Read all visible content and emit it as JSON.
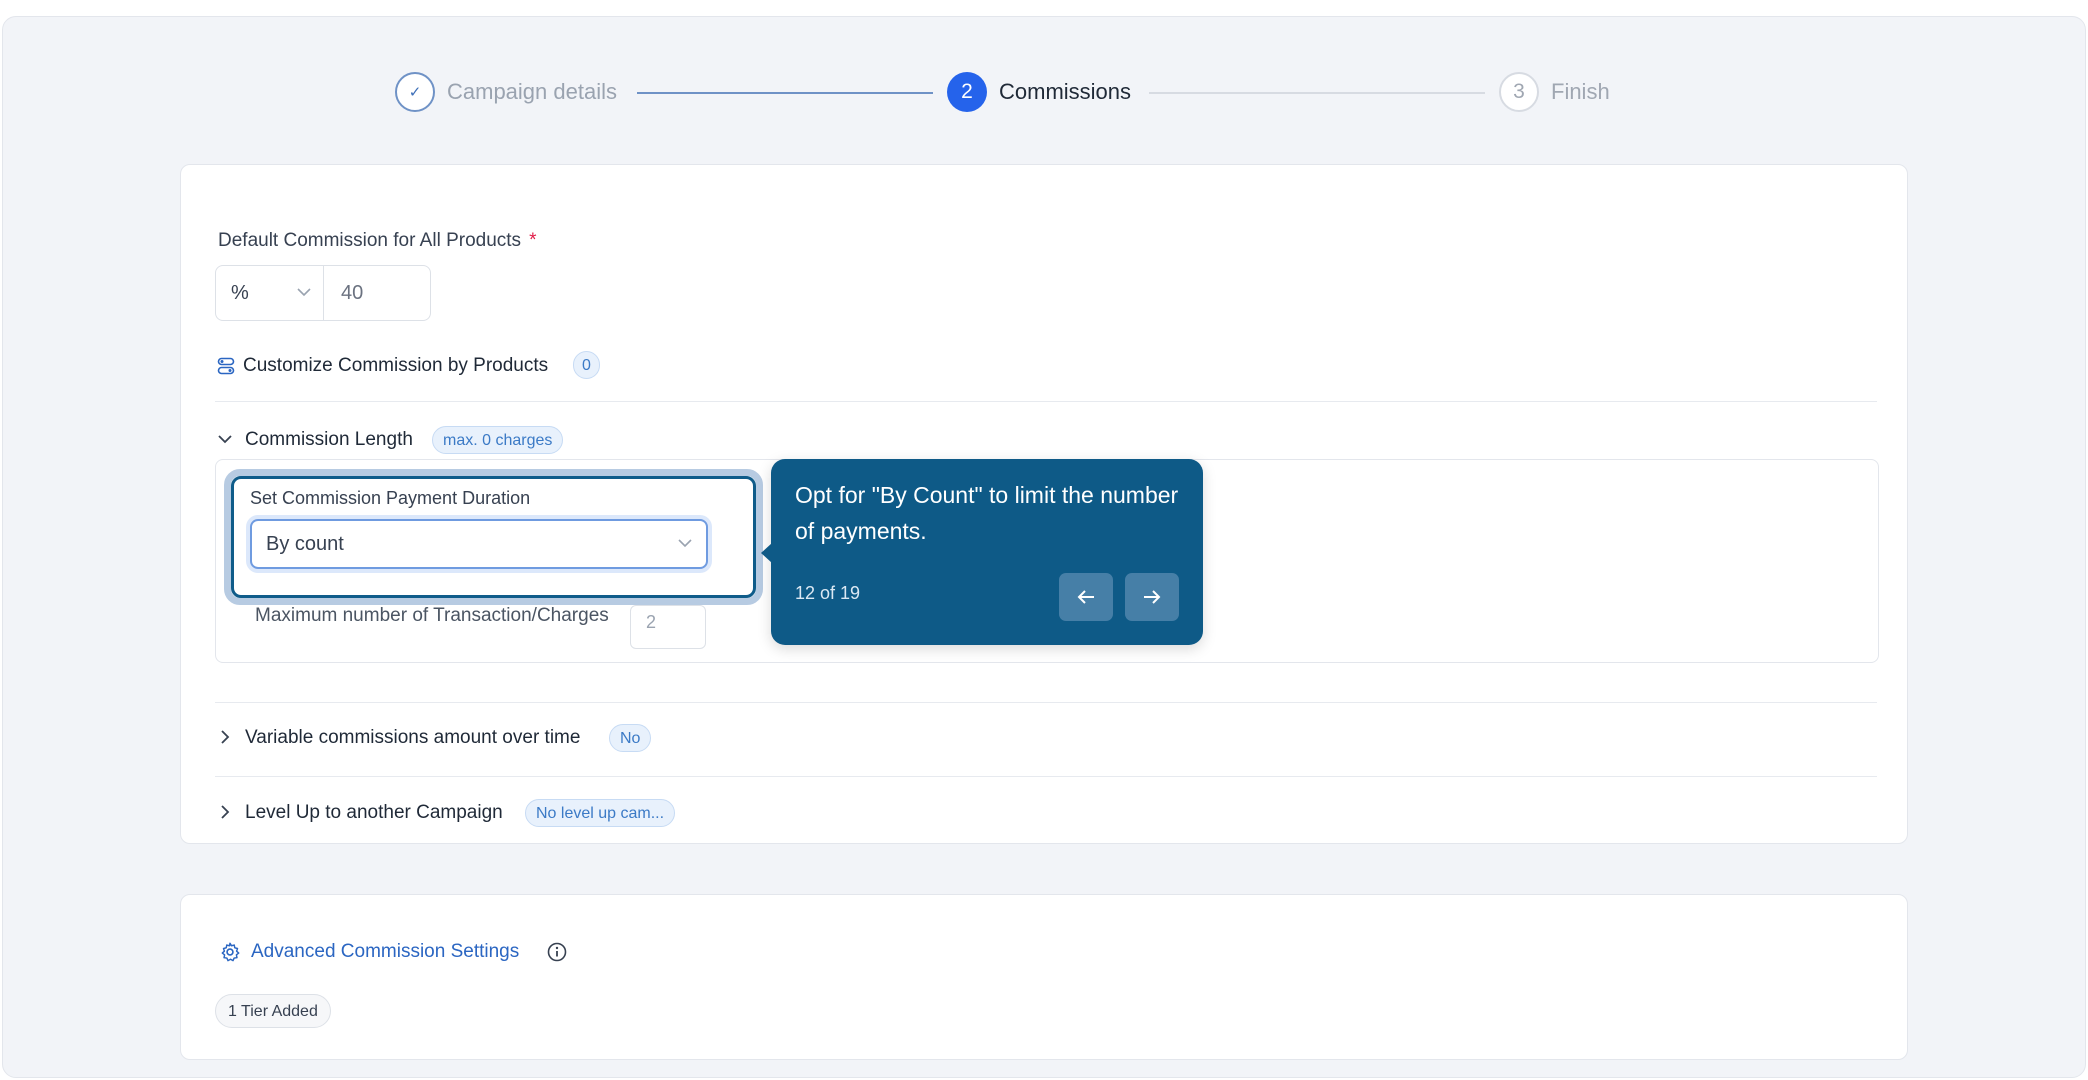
{
  "stepper": {
    "steps": [
      {
        "number": "✓",
        "label": "Campaign details",
        "state": "done"
      },
      {
        "number": "2",
        "label": "Commissions",
        "state": "active"
      },
      {
        "number": "3",
        "label": "Finish",
        "state": "upcoming"
      }
    ]
  },
  "default_commission": {
    "label": "Default Commission for All Products",
    "required_mark": "*",
    "unit": "%",
    "value": "40"
  },
  "customize": {
    "label": "Customize Commission by Products",
    "count": "0"
  },
  "commission_length": {
    "label": "Commission Length",
    "badge": "max. 0 charges",
    "duration_label": "Set Commission Payment Duration",
    "duration_value": "By count",
    "max_label": "Maximum number of Transaction/Charges",
    "max_value": "2"
  },
  "variable": {
    "label": "Variable commissions amount over time",
    "badge": "No"
  },
  "level_up": {
    "label": "Level Up to another Campaign",
    "badge": "No level up cam..."
  },
  "tooltip": {
    "text": "Opt for \"By Count\" to limit the number of payments.",
    "progress": "12 of 19"
  },
  "advanced": {
    "title": "Advanced Commission Settings",
    "tier_badge": "1 Tier Added"
  },
  "colors": {
    "primary": "#2563eb",
    "tooltip_bg": "#0e5a87",
    "badge_text": "#3b7ac6"
  }
}
